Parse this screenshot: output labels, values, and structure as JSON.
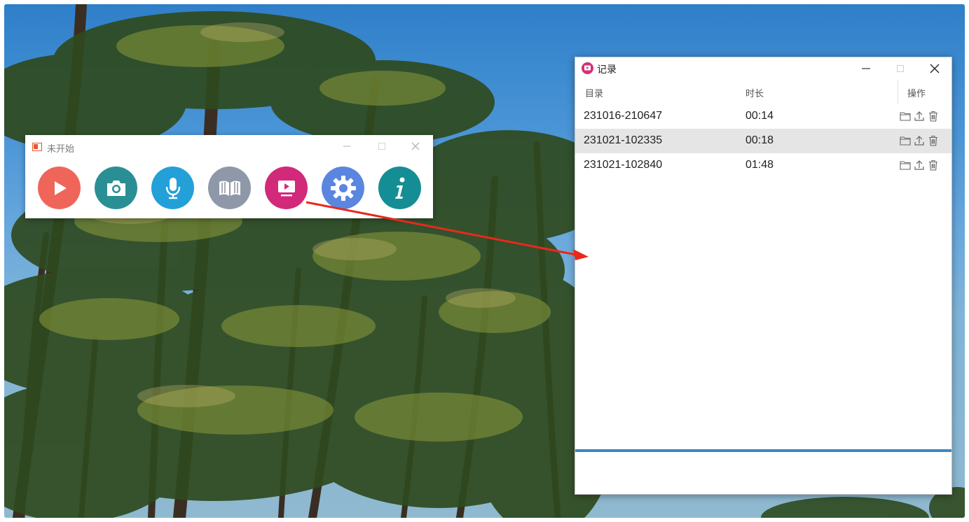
{
  "recorder": {
    "title": "未开始",
    "buttons": [
      {
        "name": "start-record-button",
        "icon": "play-icon",
        "color": "#f0655a"
      },
      {
        "name": "screenshot-button",
        "icon": "camera-icon",
        "color": "#2a8f94"
      },
      {
        "name": "microphone-button",
        "icon": "microphone-icon",
        "color": "#23a0d8"
      },
      {
        "name": "guide-button",
        "icon": "book-icon",
        "color": "#8e98a8"
      },
      {
        "name": "records-button",
        "icon": "video-list-icon",
        "color": "#d2297a"
      },
      {
        "name": "settings-button",
        "icon": "gear-icon",
        "color": "#5b86e0"
      },
      {
        "name": "about-button",
        "icon": "info-icon",
        "color": "#148e94"
      }
    ]
  },
  "records": {
    "title": "记录",
    "columns": {
      "directory": "目录",
      "duration": "时长",
      "actions": "操作"
    },
    "rows": [
      {
        "directory": "231016-210647",
        "duration": "00:14"
      },
      {
        "directory": "231021-102335",
        "duration": "00:18"
      },
      {
        "directory": "231021-102840",
        "duration": "01:48"
      }
    ],
    "selected_row": 2
  }
}
